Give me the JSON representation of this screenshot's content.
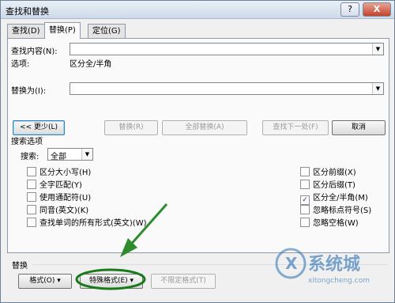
{
  "window": {
    "title": "查找和替换",
    "help_label": "?",
    "close_label": "X"
  },
  "tabs": [
    {
      "label": "查找(D)"
    },
    {
      "label": "替换(P)"
    },
    {
      "label": "定位(G)"
    }
  ],
  "find": {
    "label": "查找内容(N):",
    "value": "",
    "options_label": "选项:",
    "options_value": "区分全/半角"
  },
  "replace": {
    "label": "替换为(I):",
    "value": ""
  },
  "buttons": {
    "less": "<< 更少(L)",
    "replace": "替换(R)",
    "replace_all": "全部替换(A)",
    "find_next": "查找下一处(F)",
    "cancel": "取消"
  },
  "search_options": {
    "heading": "搜索选项",
    "search_label": "搜索:",
    "search_value": "全部",
    "left_checkboxes": [
      {
        "label": "区分大小写(H)",
        "checked": false
      },
      {
        "label": "全字匹配(Y)",
        "checked": false
      },
      {
        "label": "使用通配符(U)",
        "checked": false
      },
      {
        "label": "同音(英文)(K)",
        "checked": false
      },
      {
        "label": "查找单词的所有形式(英文)(W)",
        "checked": false
      }
    ],
    "right_checkboxes": [
      {
        "label": "区分前缀(X)",
        "checked": false
      },
      {
        "label": "区分后缀(T)",
        "checked": false
      },
      {
        "label": "区分全/半角(M)",
        "checked": true
      },
      {
        "label": "忽略标点符号(S)",
        "checked": false
      },
      {
        "label": "忽略空格(W)",
        "checked": false
      }
    ]
  },
  "replace_section": {
    "heading": "替换",
    "format": "格式(O) ▾",
    "special": "特殊格式(E) ▾",
    "no_format": "不限定格式(T)"
  },
  "watermark": {
    "brand": "系统城",
    "url": "xitongcheng.com"
  },
  "colors": {
    "arrow": "#2e8b2e",
    "highlight_ellipse": "#1a7a1a",
    "watermark": "#2a6fb0"
  }
}
